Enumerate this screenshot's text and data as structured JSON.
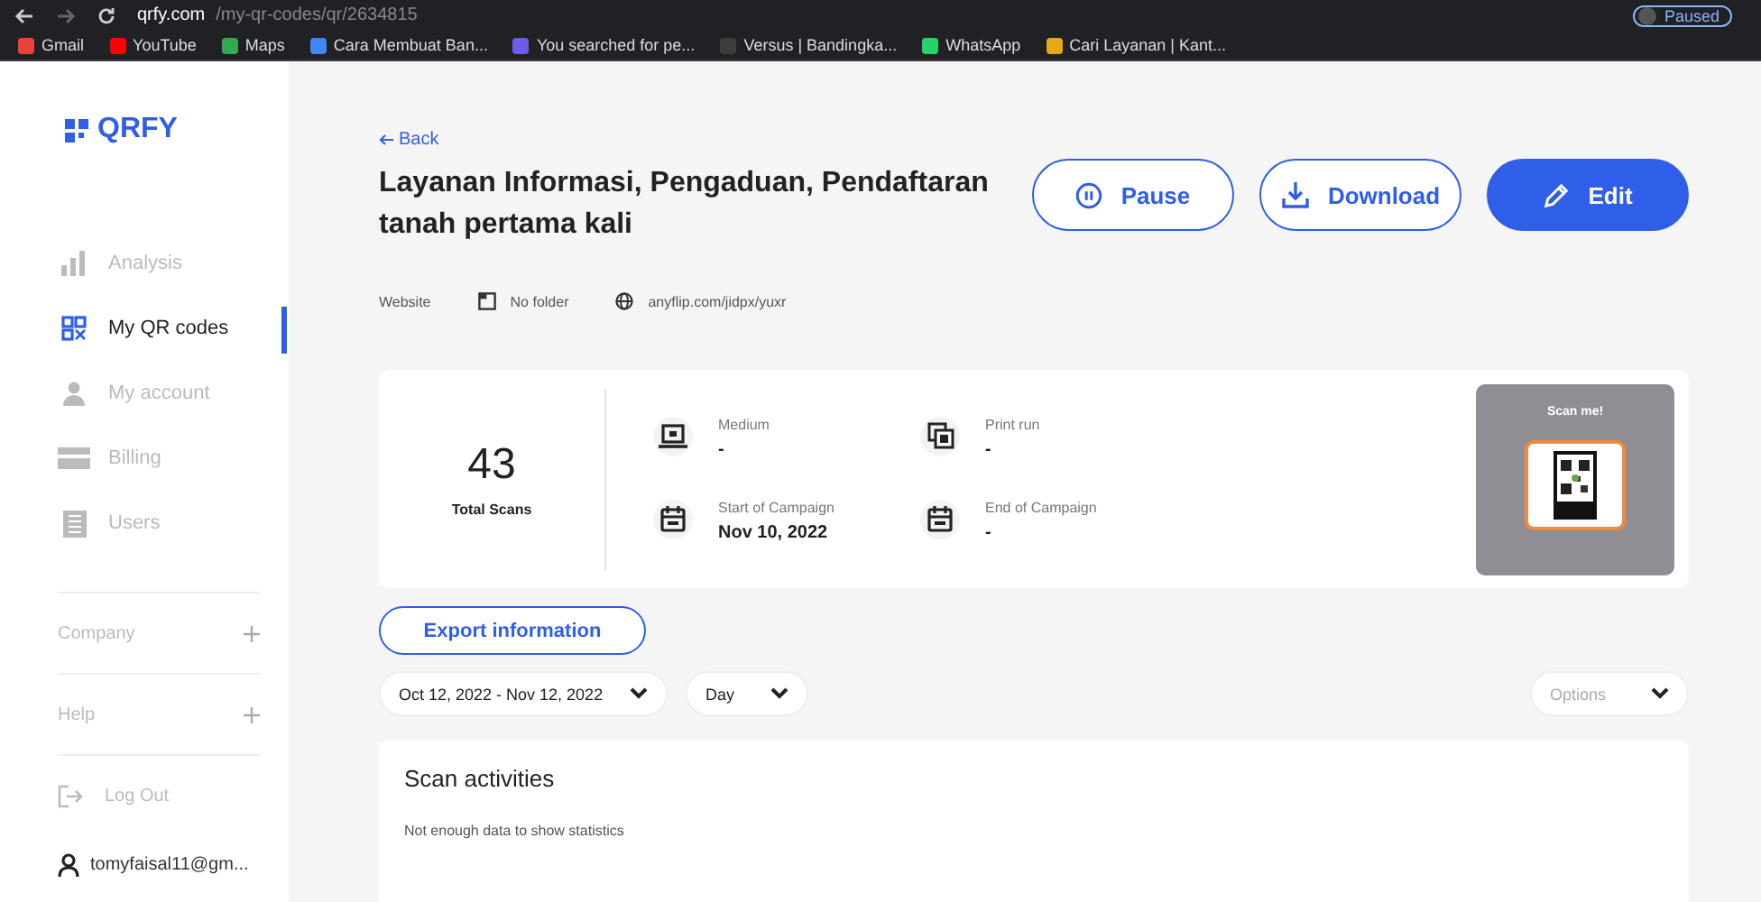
{
  "browser": {
    "url_host": "qrfy.com",
    "url_path": "/my-qr-codes/qr/2634815",
    "profile": "Paused",
    "bookmarks": [
      {
        "label": "Gmail",
        "color": "#ea4335"
      },
      {
        "label": "YouTube",
        "color": "#ff0000"
      },
      {
        "label": "Maps",
        "color": "#34a853"
      },
      {
        "label": "Cara Membuat Ban...",
        "color": "#4285f4"
      },
      {
        "label": "You searched for pe...",
        "color": "#6c5ce7"
      },
      {
        "label": "Versus | Bandingka...",
        "color": "#3c3c3c"
      },
      {
        "label": "WhatsApp",
        "color": "#25d366"
      },
      {
        "label": "Cari Layanan | Kant...",
        "color": "#e6a817"
      }
    ]
  },
  "sidebar": {
    "logo": "QRFY",
    "items": [
      {
        "label": "Analysis",
        "selected": false
      },
      {
        "label": "My QR codes",
        "selected": true
      },
      {
        "label": "My account",
        "selected": false
      },
      {
        "label": "Billing",
        "selected": false
      },
      {
        "label": "Users",
        "selected": false
      }
    ],
    "sections": [
      {
        "label": "Company",
        "expanded": false
      },
      {
        "label": "Help",
        "expanded": false
      }
    ],
    "logout": "Log Out",
    "user": "tomyfaisal11@gm..."
  },
  "header": {
    "back": "Back",
    "title": "Layanan Informasi, Pengaduan, Pendaftaran tanah pertama kali",
    "buttons": [
      {
        "label": "Pause",
        "kind": "pause"
      },
      {
        "label": "Download",
        "kind": "download"
      },
      {
        "label": "Edit",
        "kind": "edit"
      }
    ],
    "meta": {
      "type": "Website",
      "folder": "No folder",
      "url": "anyflip.com/jidpx/yuxr"
    }
  },
  "stats": {
    "total": "43",
    "total_label": "Total Scans",
    "fields": [
      {
        "label": "Medium",
        "value": "-",
        "kind": "medium"
      },
      {
        "label": "Print run",
        "value": "-",
        "kind": "print"
      },
      {
        "label": "Start of Campaign",
        "value": "Nov 10, 2022",
        "kind": "date"
      },
      {
        "label": "End of Campaign",
        "value": "-",
        "kind": "date"
      }
    ],
    "preview_title": "Scan me!"
  },
  "export_button": "Export information",
  "filters": {
    "date_range": "Oct 12, 2022 - Nov 12, 2022",
    "interval": "Day",
    "options": {
      "placeholder": "Options"
    }
  },
  "scan_activities": {
    "title": "Scan activities",
    "message": "Not enough data to show statistics"
  }
}
